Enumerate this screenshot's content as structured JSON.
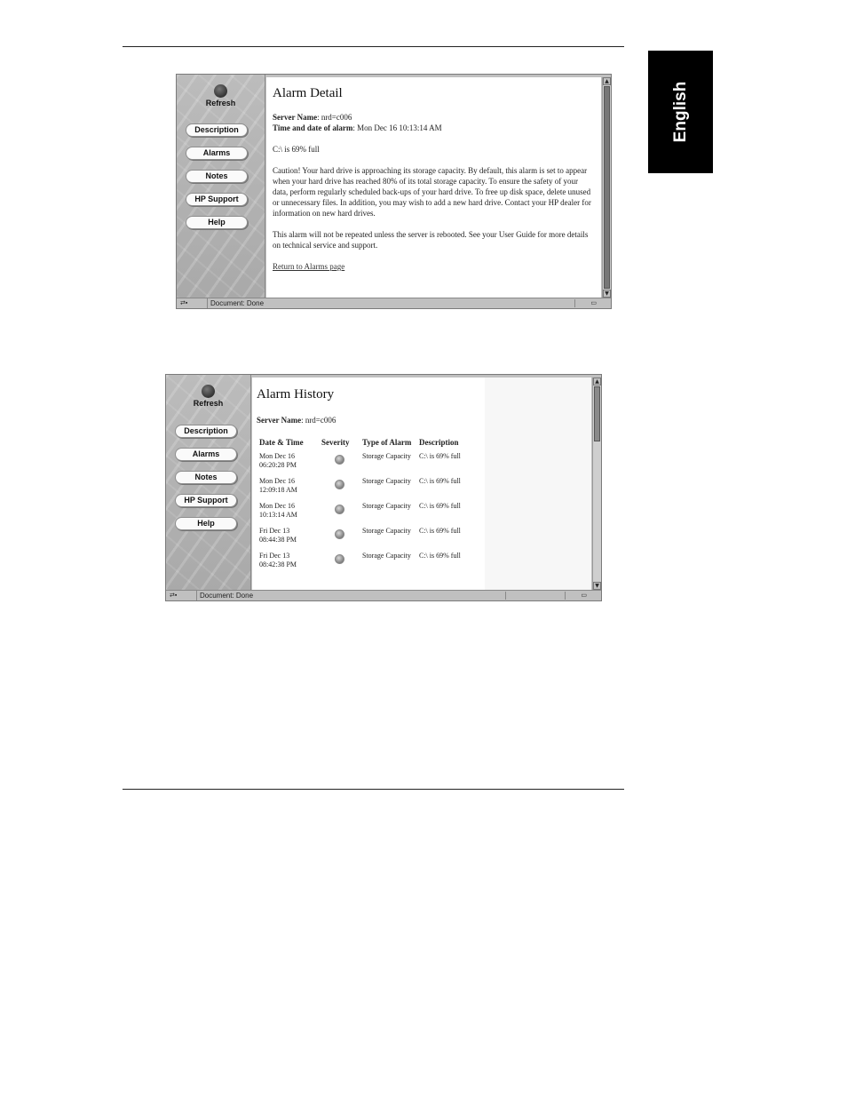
{
  "side_tab": {
    "label": "English"
  },
  "nav": {
    "refresh": "Refresh",
    "items": [
      {
        "label": "Description"
      },
      {
        "label": "Alarms"
      },
      {
        "label": "Notes"
      },
      {
        "label": "HP Support"
      },
      {
        "label": "Help"
      }
    ]
  },
  "alarm_detail": {
    "title": "Alarm Detail",
    "server_label": "Server Name",
    "server_value": ": nrd=c006",
    "time_label": "Time and date of alarm",
    "time_value": ": Mon Dec 16 10:13:14 AM",
    "summary": "C:\\ is 69% full",
    "caution": "Caution! Your hard drive is approaching its storage capacity. By default, this alarm is set to appear when your hard drive has reached 80% of its total storage capacity. To ensure the safety of your data, perform regularly scheduled back-ups of your hard drive. To free up disk space, delete unused or unnecessary files. In addition, you may wish to add a new hard drive. Contact your HP dealer for information on new hard drives.",
    "repeat_note": "This alarm will not be repeated unless the server is rebooted. See your User Guide for more details on technical service and support.",
    "return_link": "Return to Alarms page"
  },
  "alarm_history": {
    "title": "Alarm History",
    "server_label": "Server Name",
    "server_value": ": nrd=c006",
    "columns": [
      "Date & Time",
      "Severity",
      "Type of Alarm",
      "Description"
    ],
    "rows": [
      {
        "datetime": "Mon Dec 16 06:20:28 PM",
        "type": "Storage Capacity",
        "description": "C:\\ is 69% full"
      },
      {
        "datetime": "Mon Dec 16 12:09:18 AM",
        "type": "Storage Capacity",
        "description": "C:\\ is 69% full"
      },
      {
        "datetime": "Mon Dec 16 10:13:14 AM",
        "type": "Storage Capacity",
        "description": "C:\\ is 69% full"
      },
      {
        "datetime": "Fri Dec 13 08:44:38 PM",
        "type": "Storage Capacity",
        "description": "C:\\ is 69% full"
      },
      {
        "datetime": "Fri Dec 13 08:42:38 PM",
        "type": "Storage Capacity",
        "description": "C:\\ is 69% full"
      }
    ]
  },
  "statusbar": {
    "text": "Document: Done",
    "left_icon": "network-status-icon",
    "right_icon": "security-lock-icon"
  },
  "icons": {
    "refresh": "refresh-dot-icon",
    "severity": "severity-dot-icon",
    "scroll_up": "scroll-up-arrow-icon",
    "scroll_down": "scroll-down-arrow-icon"
  }
}
